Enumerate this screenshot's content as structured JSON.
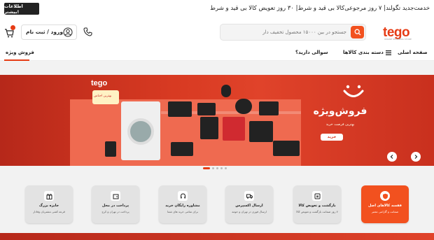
{
  "topbar": {
    "more_button": "اطلاعات بیشتر!",
    "promo_text": "خدمت‌جدید تگو‌لند| ۷ روز مرجوعی‌کالا بی قید و شرط| ۳۰ روز تعویض کالا بی قید و شرط"
  },
  "header": {
    "logo": "tego",
    "logo_tagline": "ONLINE SHOPPING STORE",
    "search_placeholder": "جستجو در بین ۱۵۰۰۰ محصول تخفیف دار",
    "login_label": "ورود / ثبت نام"
  },
  "nav": {
    "home": "صفحه اصلی",
    "categories": "دسته بندی کالاها",
    "faq": "سوالی دارید؟",
    "sale": "فروش ویژه"
  },
  "banner": {
    "brand": "tego",
    "tag_text": "بهترین اجناس",
    "title": "فروش‌ویژه",
    "subtitle": "بهترین فرصت خرید",
    "buy_button": "خرید"
  },
  "features": [
    {
      "title": "جایزه بزرگ",
      "subtitle": "قرعه کشی مشتریان وفادار",
      "icon": "gift-icon"
    },
    {
      "title": "پرداخت در محل",
      "subtitle": "پرداخت در تهران و کرج",
      "icon": "wallet-icon"
    },
    {
      "title": "مشاوره رایگان خرید",
      "subtitle": "برای تمامی خرید های شما",
      "icon": "support-icon"
    },
    {
      "title": "ارسال اکسپرس",
      "subtitle": "ارسال فوری در تهران و حومه",
      "icon": "truck-icon"
    },
    {
      "title": "بازگشت و تعویض کالا",
      "subtitle": "۷ روز ضمانت بازگشت و تعویض کالا",
      "icon": "return-icon"
    },
    {
      "title": "قفسه کالاهای اصل",
      "subtitle": "ضمانت و گارانتی معتبر",
      "icon": "shield-icon"
    }
  ],
  "colors": {
    "accent": "#f2511f",
    "banner": "#d83a22"
  }
}
